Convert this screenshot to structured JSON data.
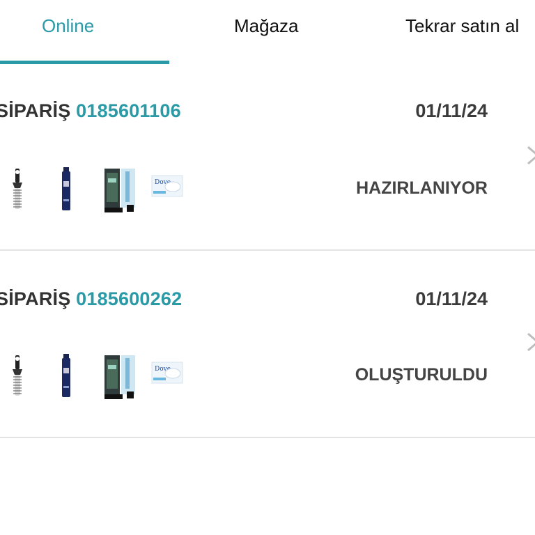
{
  "tabs": [
    {
      "label": "Online",
      "active": true
    },
    {
      "label": "Mağaza",
      "active": false
    },
    {
      "label": "Tekrar satın al",
      "active": false
    }
  ],
  "colors": {
    "accent": "#2a9aa6",
    "divider": "#e3e3e3"
  },
  "orders": [
    {
      "prefix": "SİPARİŞ",
      "number": "0185601106",
      "date": "01/11/24",
      "status": "HAZIRLANIYOR",
      "items": [
        "hair-brush",
        "hair-spray-can",
        "deodorant-box",
        "dove-soap-box"
      ]
    },
    {
      "prefix": "SİPARİŞ",
      "number": "0185600262",
      "date": "01/11/24",
      "status": "OLUŞTURULDU",
      "items": [
        "hair-brush",
        "hair-spray-can",
        "deodorant-box",
        "dove-soap-box"
      ]
    }
  ],
  "icons": {
    "chevron": "chevron-right-icon"
  },
  "product_texts": {
    "dove": "Dove"
  }
}
